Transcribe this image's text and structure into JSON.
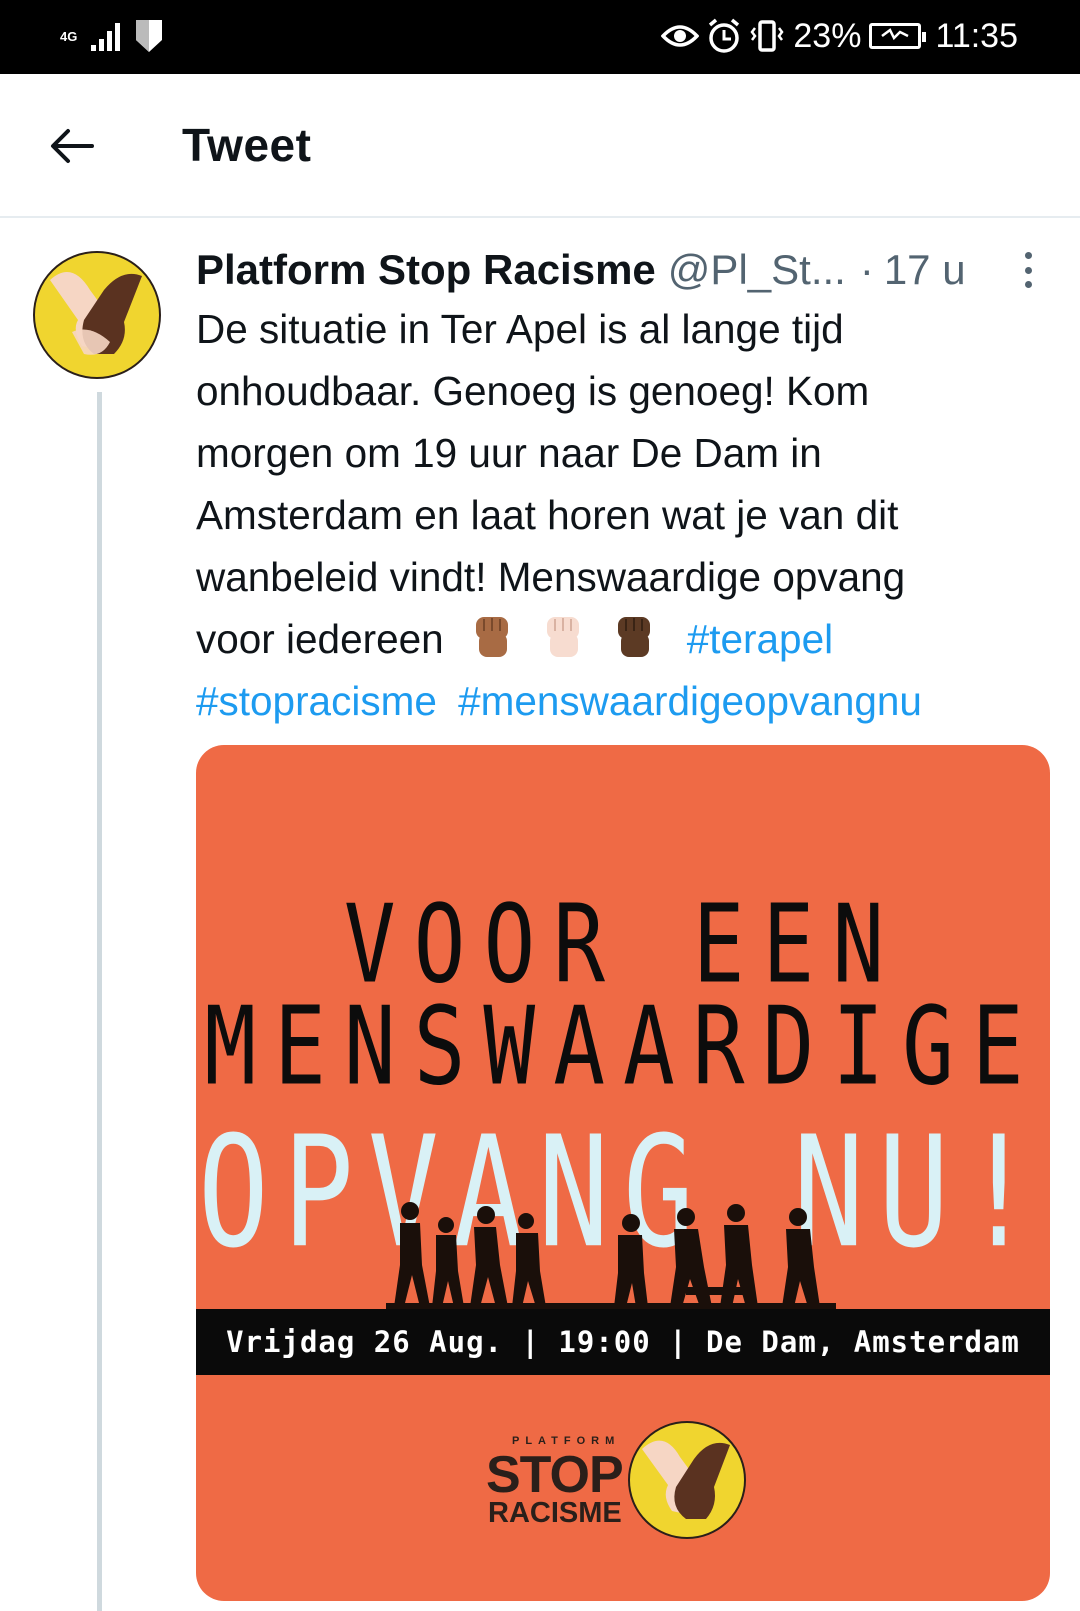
{
  "status_bar": {
    "network": "4G",
    "battery_percent": "23%",
    "time": "11:35"
  },
  "header": {
    "title": "Tweet"
  },
  "tweet": {
    "author_name": "Platform Stop Racisme",
    "handle": "@Pl_St...",
    "separator": "·",
    "time_ago": "17 u",
    "text_lines": [
      "De situatie in Ter Apel is al lange tijd",
      "onhoudbaar. Genoeg is genoeg! Kom",
      "morgen om 19 uur naar De Dam in",
      "Amsterdam en laat horen wat je van dit",
      "wanbeleid vindt! Menswaardige opvang",
      "voor iedereen"
    ],
    "hashtags": [
      "#terapel",
      "#stopracisme",
      "#menswaardigeopvangnu"
    ],
    "emoji_names": [
      "raised-fist-medium-skin",
      "raised-fist-light-skin",
      "raised-fist-dark-skin"
    ]
  },
  "media": {
    "headline_line1": "VOOR EEN",
    "headline_line2": "MENSWAARDIGE",
    "headline_big": "OPVANG NU!",
    "event_bar": "Vrijdag 26 Aug. | 19:00 | De Dam, Amsterdam",
    "logo_small": "PLATFORM",
    "logo_stop": "STOP",
    "logo_racisme": "RACISME",
    "background_color": "#ef6a45"
  },
  "colors": {
    "accent_link": "#1d9bf0",
    "secondary_text": "#536471"
  }
}
